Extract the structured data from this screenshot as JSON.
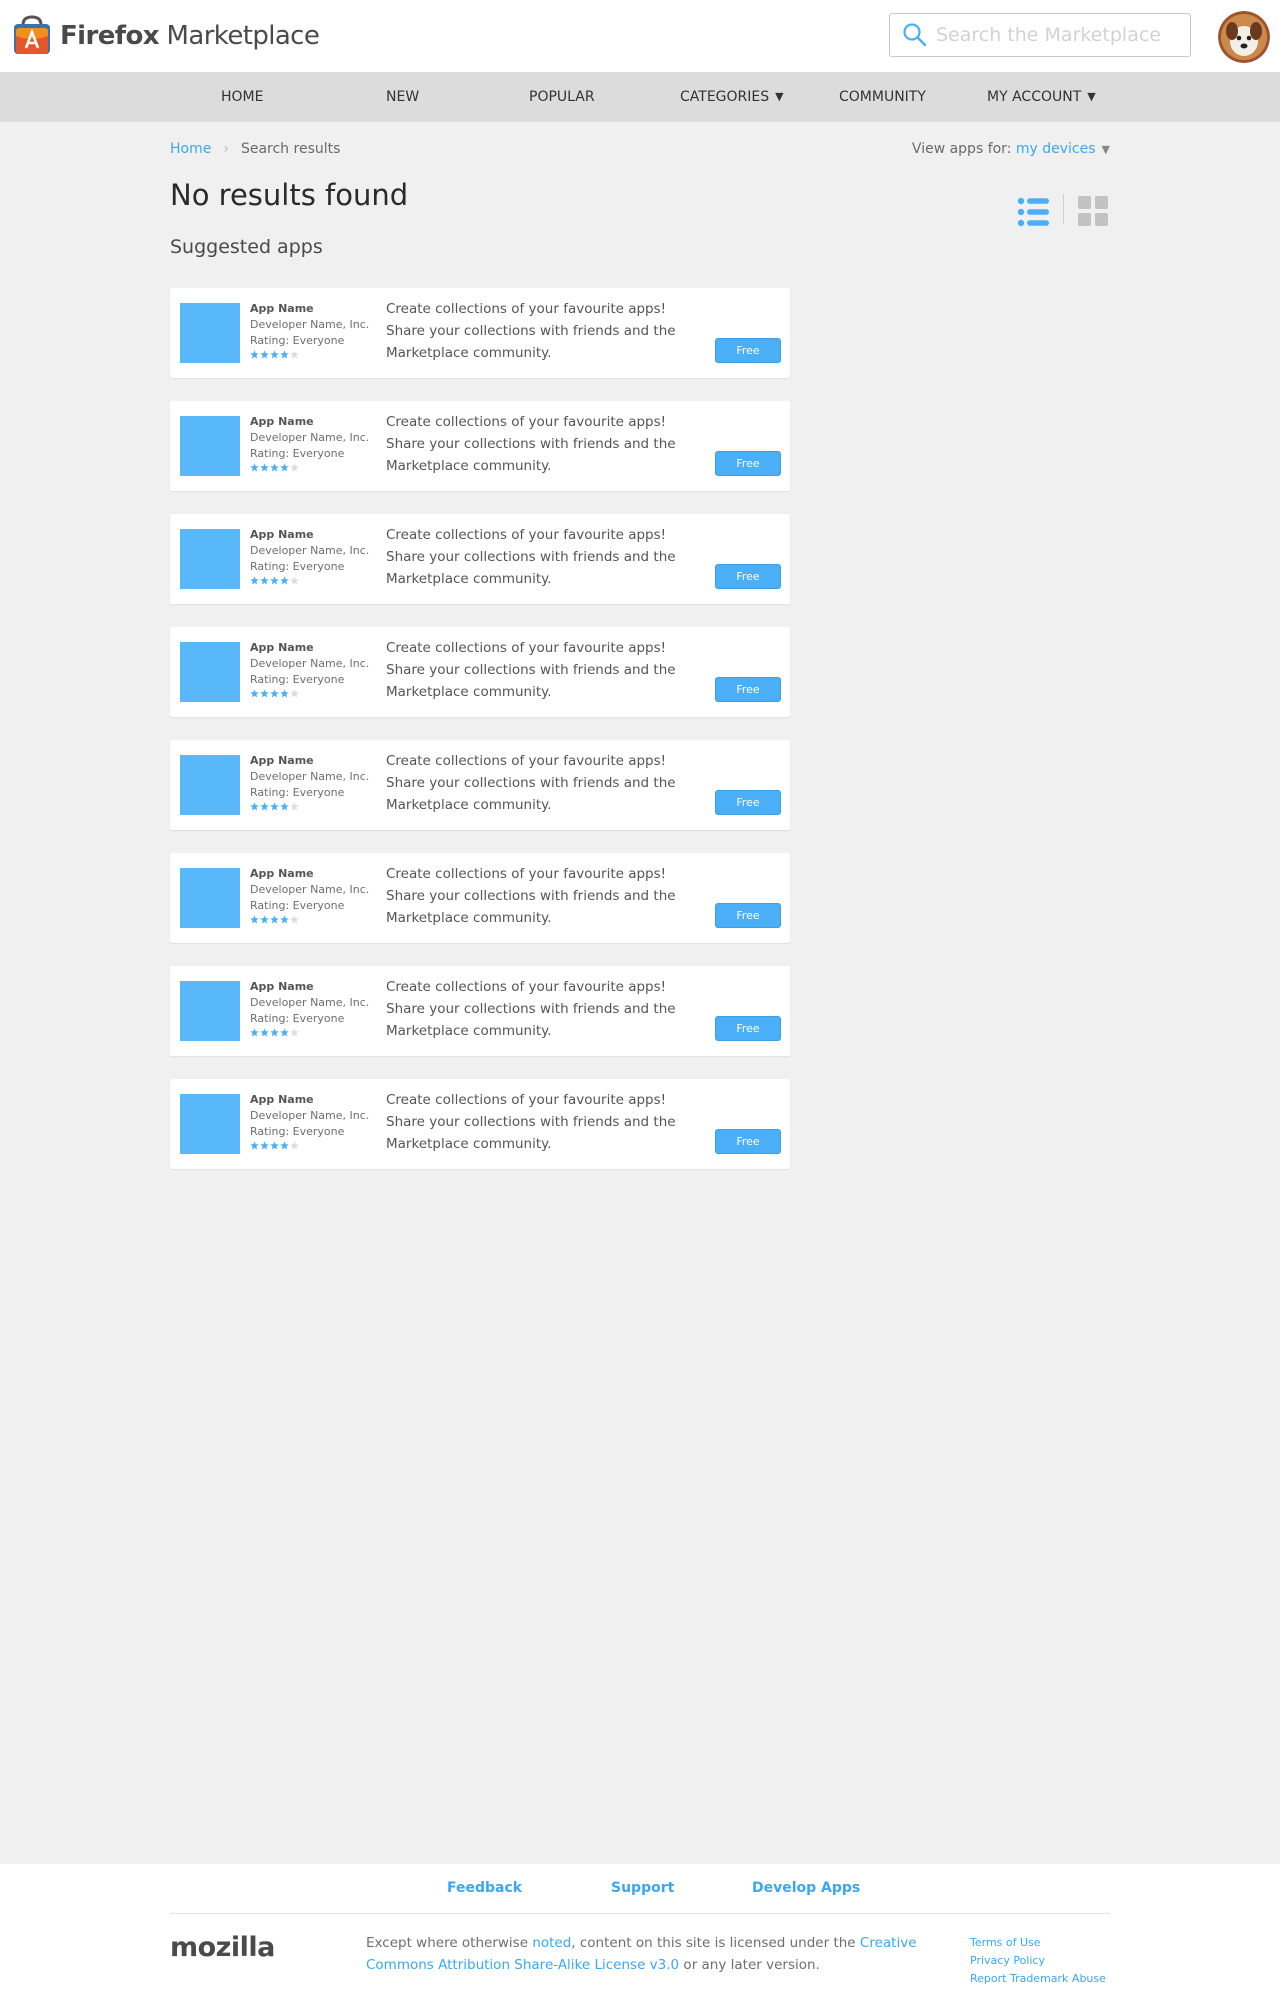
{
  "header": {
    "logo_bold": "Firefox",
    "logo_rest": " Marketplace",
    "search_placeholder": "Search the Marketplace"
  },
  "nav": {
    "items": [
      {
        "label": "Home"
      },
      {
        "label": "New"
      },
      {
        "label": "Popular"
      },
      {
        "label": "Categories",
        "caret": "▼"
      },
      {
        "label": "Community"
      },
      {
        "label": "My Account",
        "caret": "▼"
      }
    ]
  },
  "breadcrumb": {
    "home": "Home",
    "separator": "›",
    "current": "Search results"
  },
  "view_for": {
    "label": "View apps for:",
    "value": "my devices",
    "caret": "▼"
  },
  "main": {
    "title": "No results found",
    "subtitle": "Suggested apps"
  },
  "apps": [
    {
      "name": "App Name",
      "developer": "Developer Name, Inc.",
      "rating": "Rating: Everyone",
      "stars": 4,
      "description": "Create collections of your favourite apps! Share your collections with friends and the Marketplace community.",
      "button": "Free"
    },
    {
      "name": "App Name",
      "developer": "Developer Name, Inc.",
      "rating": "Rating: Everyone",
      "stars": 4,
      "description": "Create collections of your favourite apps! Share your collections with friends and the Marketplace community.",
      "button": "Free"
    },
    {
      "name": "App Name",
      "developer": "Developer Name, Inc.",
      "rating": "Rating: Everyone",
      "stars": 4,
      "description": "Create collections of your favourite apps! Share your collections with friends and the Marketplace community.",
      "button": "Free"
    },
    {
      "name": "App Name",
      "developer": "Developer Name, Inc.",
      "rating": "Rating: Everyone",
      "stars": 4,
      "description": "Create collections of your favourite apps! Share your collections with friends and the Marketplace community.",
      "button": "Free"
    },
    {
      "name": "App Name",
      "developer": "Developer Name, Inc.",
      "rating": "Rating: Everyone",
      "stars": 4,
      "description": "Create collections of your favourite apps! Share your collections with friends and the Marketplace community.",
      "button": "Free"
    },
    {
      "name": "App Name",
      "developer": "Developer Name, Inc.",
      "rating": "Rating: Everyone",
      "stars": 4,
      "description": "Create collections of your favourite apps! Share your collections with friends and the Marketplace community.",
      "button": "Free"
    },
    {
      "name": "App Name",
      "developer": "Developer Name, Inc.",
      "rating": "Rating: Everyone",
      "stars": 4,
      "description": "Create collections of your favourite apps! Share your collections with friends and the Marketplace community.",
      "button": "Free"
    },
    {
      "name": "App Name",
      "developer": "Developer Name, Inc.",
      "rating": "Rating: Everyone",
      "stars": 4,
      "description": "Create collections of your favourite apps! Share your collections with friends and the Marketplace community.",
      "button": "Free"
    }
  ],
  "footer": {
    "links": [
      "Feedback",
      "Support",
      "Develop Apps"
    ],
    "brand": "mozilla",
    "license_pre": "Except where otherwise ",
    "license_link1": "noted",
    "license_mid": ", content on this site is licensed under the ",
    "license_link2": "Creative Commons Attribution Share-Alike License v3.0",
    "license_post": " or any later version.",
    "legal": [
      "Terms of Use",
      "Privacy Policy",
      "Report Trademark Abuse"
    ]
  },
  "colors": {
    "accent": "#3aa7f0",
    "app_icon": "#58b8fa",
    "nav_bg": "#dcdcdc",
    "page_bg": "#f0f0f0"
  },
  "icons": {
    "logo": "firefox-marketplace-bag-icon",
    "search": "search-icon",
    "list_view": "list-view-icon",
    "grid_view": "grid-view-icon",
    "star": "star-icon"
  }
}
